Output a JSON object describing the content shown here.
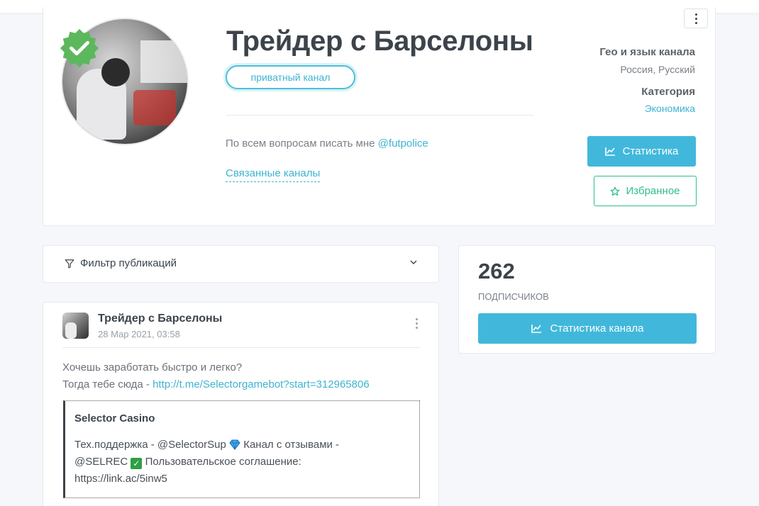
{
  "channel": {
    "title": "Трейдер с Барселоны",
    "privacy_badge": "приватный канал",
    "description_prefix": "По всем вопросам писать мне",
    "description_handle": "@futpolice",
    "related_channels_link": "Связанные каналы",
    "geo_label": "Гео и язык канала",
    "geo_value": "Россия, Русский",
    "category_label": "Категория",
    "category_value": "Экономика",
    "stats_button": "Статистика",
    "favorite_button": "Избранное"
  },
  "filter": {
    "label": "Фильтр публикаций"
  },
  "subscribers": {
    "count": "262",
    "label": "подписчиков",
    "stats_button": "Статистика канала"
  },
  "post": {
    "author": "Трейдер с Барселоны",
    "date": "28 Мар 2021, 03:58",
    "text_line1": "Хочешь заработать быстро и легко?",
    "text_line2_prefix": "Тогда тебе сюда -",
    "text_link": "http://t.me/Selectorgamebot?start=312965806",
    "preview": {
      "title": "Selector Casino",
      "part1": "Тех.поддержка - @SelectorSup",
      "part2": "Канал с отзывами -",
      "part3": "@SELREC",
      "part4": "Пользовательское соглашение:",
      "part5": "https://link.ac/5inw5"
    }
  },
  "icons": {
    "verified": "verified-badge-icon",
    "kebab": "kebab-menu-icon",
    "chart": "line-chart-icon",
    "star": "star-icon",
    "filter": "filter-funnel-icon",
    "chevron": "chevron-down-icon",
    "gem": "gem-emoji-icon",
    "check": "check-mark-emoji-icon"
  },
  "colors": {
    "accent": "#41b8db",
    "favorite": "#2fbf8a",
    "verified": "#5cb85c"
  }
}
